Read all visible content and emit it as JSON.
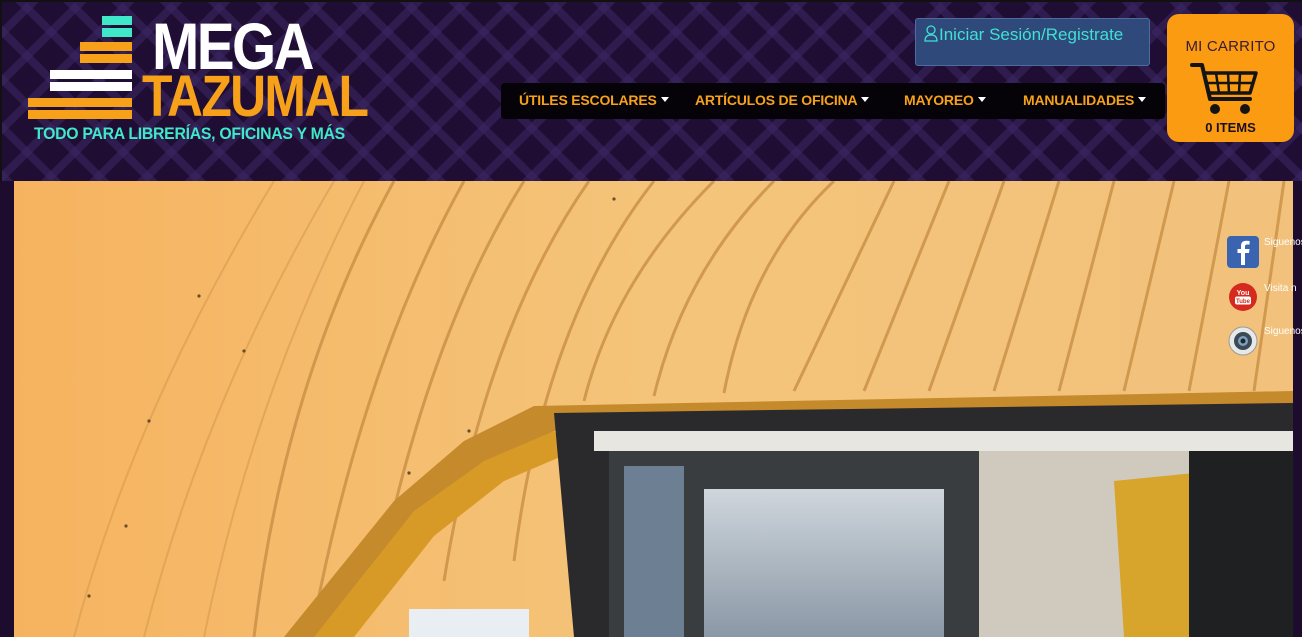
{
  "logo": {
    "word1": "MEGA",
    "word2": "TAZUMAL",
    "tagline": "TODO PARA LIBRERÍAS, OFICINAS Y MÁS"
  },
  "login": {
    "label": "Iniciar Sesión/Registrate",
    "icon": "user-icon"
  },
  "nav": {
    "items": [
      {
        "label": "ÚTILES ESCOLARES"
      },
      {
        "label": "ARTÍCULOS DE OFICINA"
      },
      {
        "label": "MAYOREO"
      },
      {
        "label": "MANUALIDADES"
      }
    ]
  },
  "cart": {
    "title": "MI CARRITO",
    "count_label": "0 ITEMS",
    "icon": "cart-icon"
  },
  "social": [
    {
      "icon": "facebook-icon",
      "label": "Siguenos"
    },
    {
      "icon": "youtube-icon",
      "label": "Visita n"
    },
    {
      "icon": "instagram-icon",
      "label": "Siguenos"
    }
  ],
  "colors": {
    "header_bg": "#200d33",
    "accent_orange": "#f7a11a",
    "accent_teal": "#3fe8c8",
    "cart_bg": "#fb9b12",
    "login_bg": "#2f4a7a"
  }
}
